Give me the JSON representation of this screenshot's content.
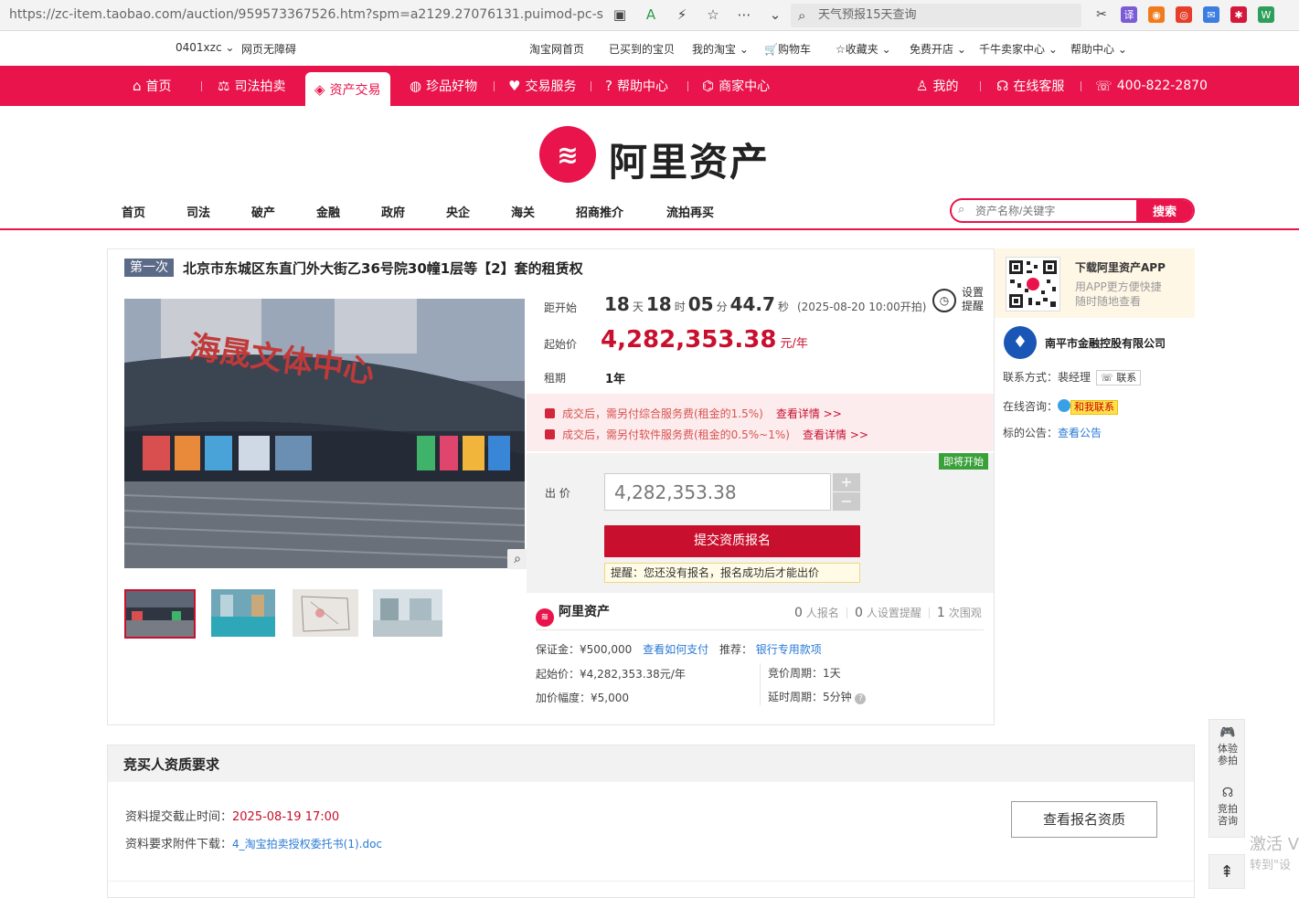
{
  "browser": {
    "url": "https://zc-item.taobao.com/auction/959573367526.htm?spm=a2129.27076131.puimod-pc-search",
    "search_text": "天气预报15天查询",
    "ext_labels": [
      "译",
      "W"
    ]
  },
  "topnav": {
    "user": "0401xzc",
    "accessibility": "网页无障碍",
    "items": [
      "淘宝网首页",
      "已买到的宝贝",
      "我的淘宝",
      "购物车",
      "收藏夹",
      "免费开店",
      "千牛卖家中心",
      "帮助中心"
    ]
  },
  "rednav": {
    "items": [
      "首页",
      "司法拍卖",
      "资产交易",
      "珍品好物",
      "交易服务",
      "帮助中心",
      "商家中心"
    ],
    "right": [
      "我的",
      "在线客服",
      "400-822-2870"
    ]
  },
  "logo_text": "阿里资产",
  "catnav": [
    "首页",
    "司法",
    "破产",
    "金融",
    "政府",
    "央企",
    "海关",
    "招商推介",
    "流拍再买"
  ],
  "search": {
    "placeholder": "资产名称/关键字",
    "button": "搜索"
  },
  "item": {
    "badge": "第一次",
    "title": "北京市东城区东直门外大街乙36号院30幢1层等【2】套的租赁权",
    "image_sign": "海晟文体中心",
    "countdown_label": "距开始",
    "cd_days": "18",
    "cd_days_u": "天",
    "cd_hours": "18",
    "cd_hours_u": "时",
    "cd_mins": "05",
    "cd_mins_u": "分",
    "cd_secs": "44.7",
    "cd_secs_u": "秒",
    "cd_start": "(2025-08-20 10:00开拍)",
    "remind": "设置\n提醒",
    "start_label": "起始价",
    "start_price": "4,282,353.38",
    "price_unit": "元/年",
    "term_label": "租期",
    "term": "1年",
    "fee1": "成交后，需另付综合服务费(租金的1.5%)",
    "fee2": "成交后，需另付软件服务费(租金的0.5%~1%)",
    "fee_link": "查看详情 >>",
    "soon": "即将开始",
    "bid_label": "出 价",
    "bid_value": "4,282,353.38",
    "submit": "提交资质报名",
    "tip": "提醒：您还没有报名，报名成功后才能出价",
    "brand": "阿里资产",
    "stats": {
      "applied": "0",
      "applied_l": "人报名",
      "remind": "0",
      "remind_l": "人设置提醒",
      "views": "1",
      "views_l": "次围观"
    },
    "deposit": "保证金：¥500,000",
    "howpay": "查看如何支付",
    "recommend": "推荐：",
    "bank": "银行专用款项",
    "start_detail": "起始价：¥4,282,353.38元/年",
    "increment": "加价幅度：¥5,000",
    "period": "竞价周期：1天",
    "delay": "延时周期：5分钟"
  },
  "side": {
    "app_title": "下载阿里资产APP",
    "app_desc": "用APP更方便快捷\n随时随地查看",
    "org": "南平市金融控股有限公司",
    "contact_label": "联系方式：",
    "contact_name": "裴经理",
    "contact_btn": "联系",
    "online_label": "在线咨询：",
    "online_btn": "和我联系",
    "notice_label": "标的公告：",
    "notice_link": "查看公告"
  },
  "req": {
    "title": "竞买人资质要求",
    "deadline_label": "资料提交截止时间：",
    "deadline": "2025-08-19 17:00",
    "attach_label": "资料要求附件下载：",
    "attach": "4_淘宝拍卖授权委托书(1).doc",
    "view_btn": "查看报名资质"
  },
  "float": {
    "try": "体验\n参拍",
    "consult": "竞拍\n咨询"
  },
  "watermark": {
    "line1": "激活 V",
    "line2": "转到\"设"
  },
  "colors": {
    "brand_red": "#e8144b",
    "price_red": "#c8102e",
    "link_blue": "#2a7ad4"
  }
}
